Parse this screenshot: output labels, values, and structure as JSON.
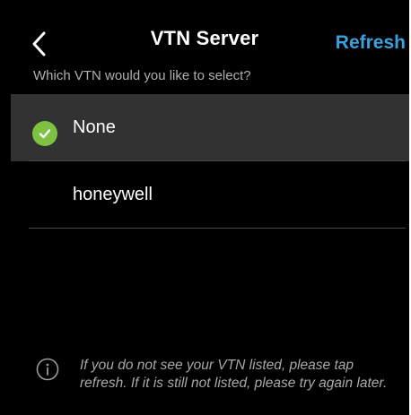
{
  "header": {
    "title": "VTN Server",
    "refresh_label": "Refresh",
    "subtitle": "Which VTN would you like to select?"
  },
  "vtn_options": [
    {
      "label": "None",
      "selected": true
    },
    {
      "label": "honeywell",
      "selected": false
    }
  ],
  "info": {
    "message": "If you do not see your VTN listed, please tap refresh. If it is still not listed, please try again later."
  },
  "colors": {
    "background": "#000000",
    "accent": "#3aa1dd",
    "selected_row": "#323232",
    "check": "#7dc243",
    "muted_text": "#b0b0b0"
  },
  "icons": {
    "back": "chevron-left-icon",
    "selected": "check-circle-icon",
    "info": "info-circle-icon"
  }
}
